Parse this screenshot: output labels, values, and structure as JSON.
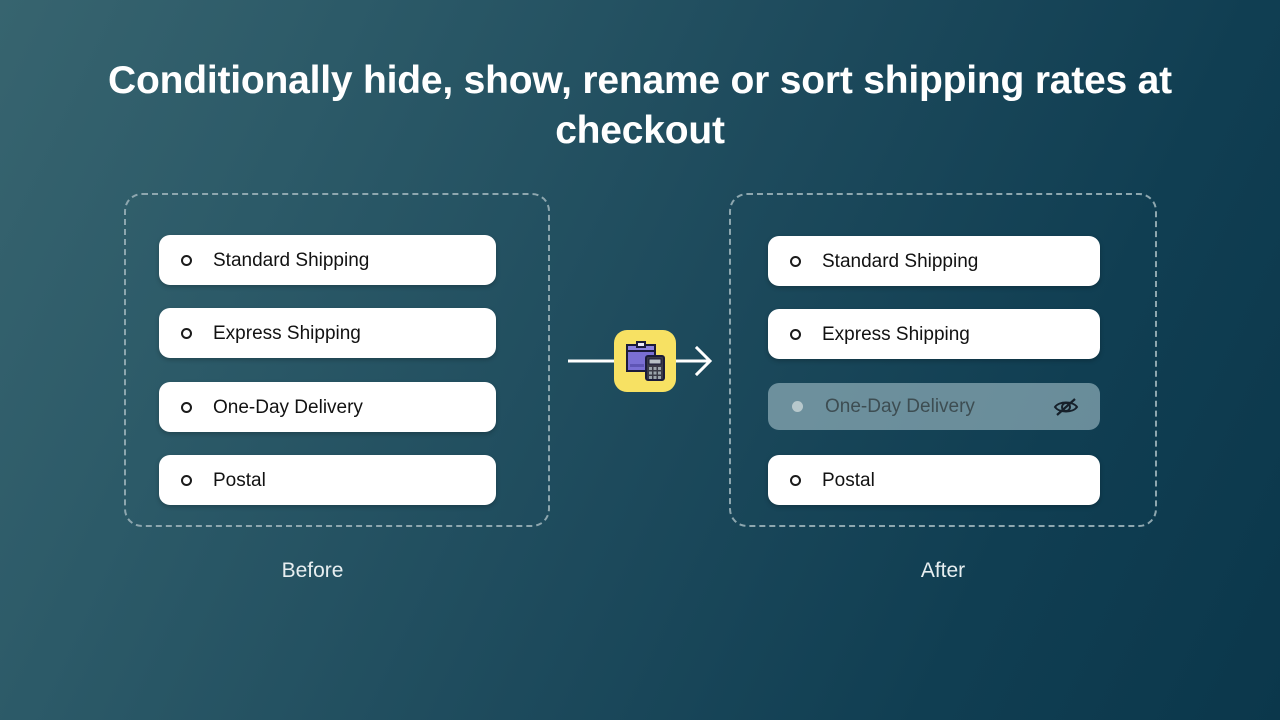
{
  "title": "Conditionally hide, show, rename or sort shipping rates at checkout",
  "theme": {
    "background_gradient_from": "#37646f",
    "background_gradient_to": "#0b374b",
    "panel_border": "#8ea7af",
    "card_background": "#ffffff",
    "card_text": "#121212",
    "hidden_card_background": "#abc7ce",
    "hidden_card_text": "#3d4d52",
    "accent_icon_background": "#f7e163",
    "accent_box_purple": "#7a6fd4",
    "arrow": "#ffffff"
  },
  "before": {
    "caption": "Before",
    "rates": [
      {
        "label": "Standard Shipping",
        "icon": "radio-circle-icon",
        "hidden": false
      },
      {
        "label": "Express Shipping",
        "icon": "radio-circle-icon",
        "hidden": false
      },
      {
        "label": "One-Day Delivery",
        "icon": "radio-circle-icon",
        "hidden": false
      },
      {
        "label": "Postal",
        "icon": "radio-circle-icon",
        "hidden": false
      }
    ]
  },
  "after": {
    "caption": "After",
    "rates": [
      {
        "label": "Standard Shipping",
        "icon": "radio-circle-icon",
        "hidden": false
      },
      {
        "label": "Express Shipping",
        "icon": "radio-circle-icon",
        "hidden": false
      },
      {
        "label": "One-Day Delivery",
        "icon": "radio-circle-icon",
        "hidden": true,
        "status_icon": "eye-slash-icon"
      },
      {
        "label": "Postal",
        "icon": "radio-circle-icon",
        "hidden": false
      }
    ]
  },
  "transform": {
    "arrow_icon": "right-arrow-icon",
    "app_icon": "shipping-rates-calculator-app-icon"
  }
}
